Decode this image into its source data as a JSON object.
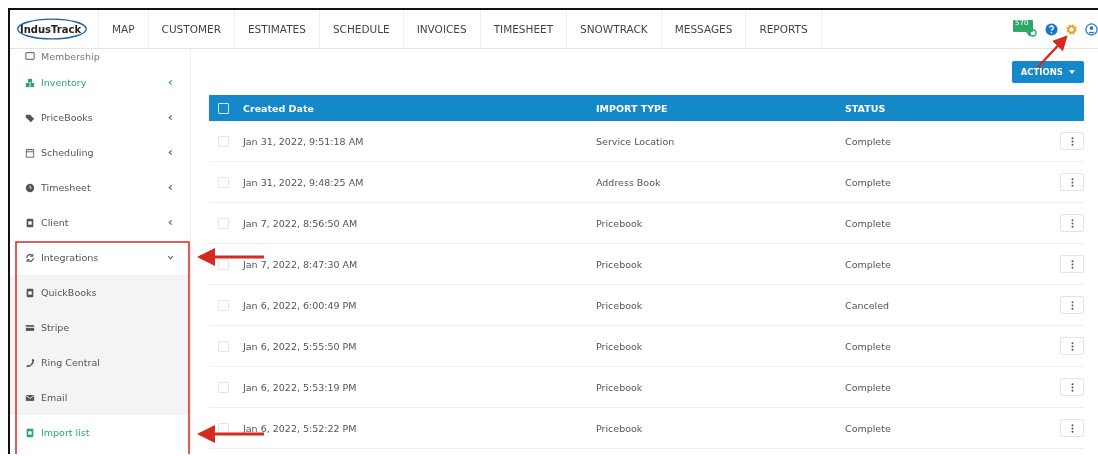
{
  "nav": {
    "logo": "IndusTrack",
    "tabs": [
      "MAP",
      "CUSTOMER",
      "ESTIMATES",
      "SCHEDULE",
      "INVOICES",
      "TIMESHEET",
      "SNOWTRACK",
      "MESSAGES",
      "REPORTS"
    ],
    "message_badge": "570"
  },
  "sidebar": {
    "items": [
      {
        "label": "Membership",
        "selected": false
      },
      {
        "label": "Inventory",
        "selected": true,
        "expanded": false
      },
      {
        "label": "PriceBooks",
        "selected": false,
        "expanded": false
      },
      {
        "label": "Scheduling",
        "selected": false,
        "expanded": false
      },
      {
        "label": "Timesheet",
        "selected": false,
        "expanded": false
      },
      {
        "label": "Client",
        "selected": false,
        "expanded": false
      },
      {
        "label": "Integrations",
        "selected": false,
        "expanded": true,
        "children": [
          {
            "label": "QuickBooks",
            "selected": false
          },
          {
            "label": "Stripe",
            "selected": false
          },
          {
            "label": "Ring Central",
            "selected": false
          },
          {
            "label": "Email",
            "selected": false
          },
          {
            "label": "Import list",
            "selected": true
          }
        ]
      }
    ]
  },
  "actions_button": "ACTIONS",
  "table": {
    "header_checked": false,
    "columns": [
      "Created Date",
      "IMPORT TYPE",
      "STATUS"
    ],
    "rows": [
      {
        "checked": false,
        "cells": [
          "Jan 31, 2022, 9:51:18 AM",
          "Service Location",
          "Complete"
        ]
      },
      {
        "checked": false,
        "cells": [
          "Jan 31, 2022, 9:48:25 AM",
          "Address Book",
          "Complete"
        ]
      },
      {
        "checked": false,
        "cells": [
          "Jan 7, 2022, 8:56:50 AM",
          "Pricebook",
          "Complete"
        ]
      },
      {
        "checked": false,
        "cells": [
          "Jan 7, 2022, 8:47:30 AM",
          "Pricebook",
          "Complete"
        ]
      },
      {
        "checked": false,
        "cells": [
          "Jan 6, 2022, 6:00:49 PM",
          "Pricebook",
          "Canceled"
        ]
      },
      {
        "checked": false,
        "cells": [
          "Jan 6, 2022, 5:55:50 PM",
          "Pricebook",
          "Complete"
        ]
      },
      {
        "checked": false,
        "cells": [
          "Jan 6, 2022, 5:53:19 PM",
          "Pricebook",
          "Complete"
        ]
      },
      {
        "checked": false,
        "cells": [
          "Jan 6, 2022, 5:52:22 PM",
          "Pricebook",
          "Complete"
        ]
      }
    ]
  }
}
